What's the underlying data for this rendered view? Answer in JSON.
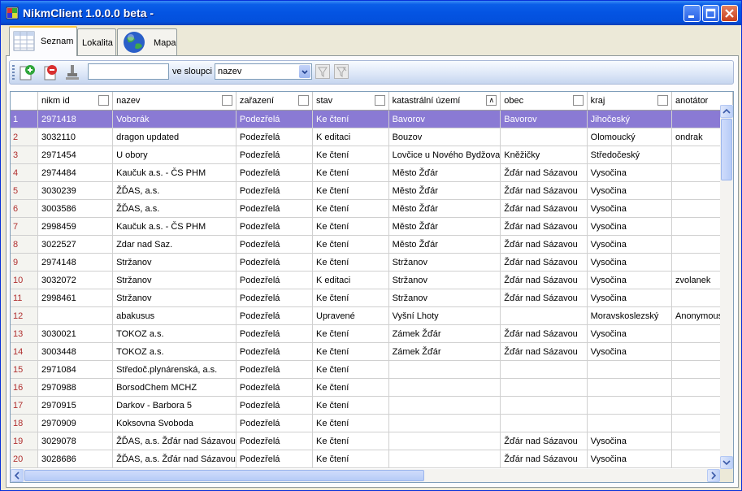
{
  "window": {
    "title": "NikmClient 1.0.0.0 beta -"
  },
  "tabs": [
    {
      "label": "Seznam",
      "icon": "table-icon"
    },
    {
      "label": "Lokalita",
      "icon": ""
    },
    {
      "label": "Mapa",
      "icon": "globe-icon"
    }
  ],
  "toolbar": {
    "search_value": "",
    "column_label": "ve sloupci",
    "column_value": "nazev"
  },
  "grid": {
    "columns": [
      "nikm id",
      "nazev",
      "zařazení",
      "stav",
      "katastrální území",
      "obec",
      "kraj",
      "anotátor"
    ],
    "sort_column": "katastrální území",
    "rows": [
      [
        "1",
        "2971418",
        "Voborák",
        "Podezřelá",
        "Ke čtení",
        "Bavorov",
        "Bavorov",
        "Jihočeský",
        ""
      ],
      [
        "2",
        "3032110",
        "dragon updated",
        "Podezřelá",
        "K editaci",
        "Bouzov",
        "",
        "Olomoucký",
        "ondrak"
      ],
      [
        "3",
        "2971454",
        "U obory",
        "Podezřelá",
        "Ke čtení",
        "Lovčice u Nového Bydžova",
        "Kněžičky",
        "Středočeský",
        ""
      ],
      [
        "4",
        "2974484",
        "Kaučuk a.s. - ČS PHM",
        "Podezřelá",
        "Ke čtení",
        "Město Žďár",
        "Žďár nad Sázavou",
        "Vysočina",
        ""
      ],
      [
        "5",
        "3030239",
        "ŽĎAS, a.s.",
        "Podezřelá",
        "Ke čtení",
        "Město Žďár",
        "Žďár nad Sázavou",
        "Vysočina",
        ""
      ],
      [
        "6",
        "3003586",
        "ŽĎAS, a.s.",
        "Podezřelá",
        "Ke čtení",
        "Město Žďár",
        "Žďár nad Sázavou",
        "Vysočina",
        ""
      ],
      [
        "7",
        "2998459",
        "Kaučuk a.s. - ČS PHM",
        "Podezřelá",
        "Ke čtení",
        "Město Žďár",
        "Žďár nad Sázavou",
        "Vysočina",
        ""
      ],
      [
        "8",
        "3022527",
        "Zdar nad Saz.",
        "Podezřelá",
        "Ke čtení",
        "Město Žďár",
        "Žďár nad Sázavou",
        "Vysočina",
        ""
      ],
      [
        "9",
        "2974148",
        "Stržanov",
        "Podezřelá",
        "Ke čtení",
        "Stržanov",
        "Žďár nad Sázavou",
        "Vysočina",
        ""
      ],
      [
        "10",
        "3032072",
        "Stržanov",
        "Podezřelá",
        "K editaci",
        "Stržanov",
        "Žďár nad Sázavou",
        "Vysočina",
        "zvolanek"
      ],
      [
        "11",
        "2998461",
        "Stržanov",
        "Podezřelá",
        "Ke čtení",
        "Stržanov",
        "Žďár nad Sázavou",
        "Vysočina",
        ""
      ],
      [
        "12",
        "",
        "abakusus",
        "Podezřelá",
        "Upravené",
        "Vyšní Lhoty",
        "",
        "Moravskoslezský",
        "Anonymous"
      ],
      [
        "13",
        "3030021",
        "TOKOZ a.s.",
        "Podezřelá",
        "Ke čtení",
        "Zámek Žďár",
        "Žďár nad Sázavou",
        "Vysočina",
        ""
      ],
      [
        "14",
        "3003448",
        "TOKOZ a.s.",
        "Podezřelá",
        "Ke čtení",
        "Zámek Žďár",
        "Žďár nad Sázavou",
        "Vysočina",
        ""
      ],
      [
        "15",
        "2971084",
        "Středoč.plynárenská, a.s.",
        "Podezřelá",
        "Ke čtení",
        "",
        "",
        "",
        ""
      ],
      [
        "16",
        "2970988",
        "BorsodChem MCHZ",
        "Podezřelá",
        "Ke čtení",
        "",
        "",
        "",
        ""
      ],
      [
        "17",
        "2970915",
        "Darkov - Barbora 5",
        "Podezřelá",
        "Ke čtení",
        "",
        "",
        "",
        ""
      ],
      [
        "18",
        "2970909",
        "Koksovna Svoboda",
        "Podezřelá",
        "Ke čtení",
        "",
        "",
        "",
        ""
      ],
      [
        "19",
        "3029078",
        "ŽĎAS, a.s. Žďár nad Sázavou",
        "Podezřelá",
        "Ke čtení",
        "",
        "Žďár nad Sázavou",
        "Vysočina",
        ""
      ],
      [
        "20",
        "3028686",
        "ŽĎAS, a.s. Žďár nad Sázavou",
        "Podezřelá",
        "Ke čtení",
        "",
        "Žďár nad Sázavou",
        "Vysočina",
        ""
      ]
    ],
    "selected_row": 1
  },
  "colors": {
    "titlebar": "#0454e2",
    "selection": "#8a7ad4",
    "row_header_text": "#b03030"
  }
}
